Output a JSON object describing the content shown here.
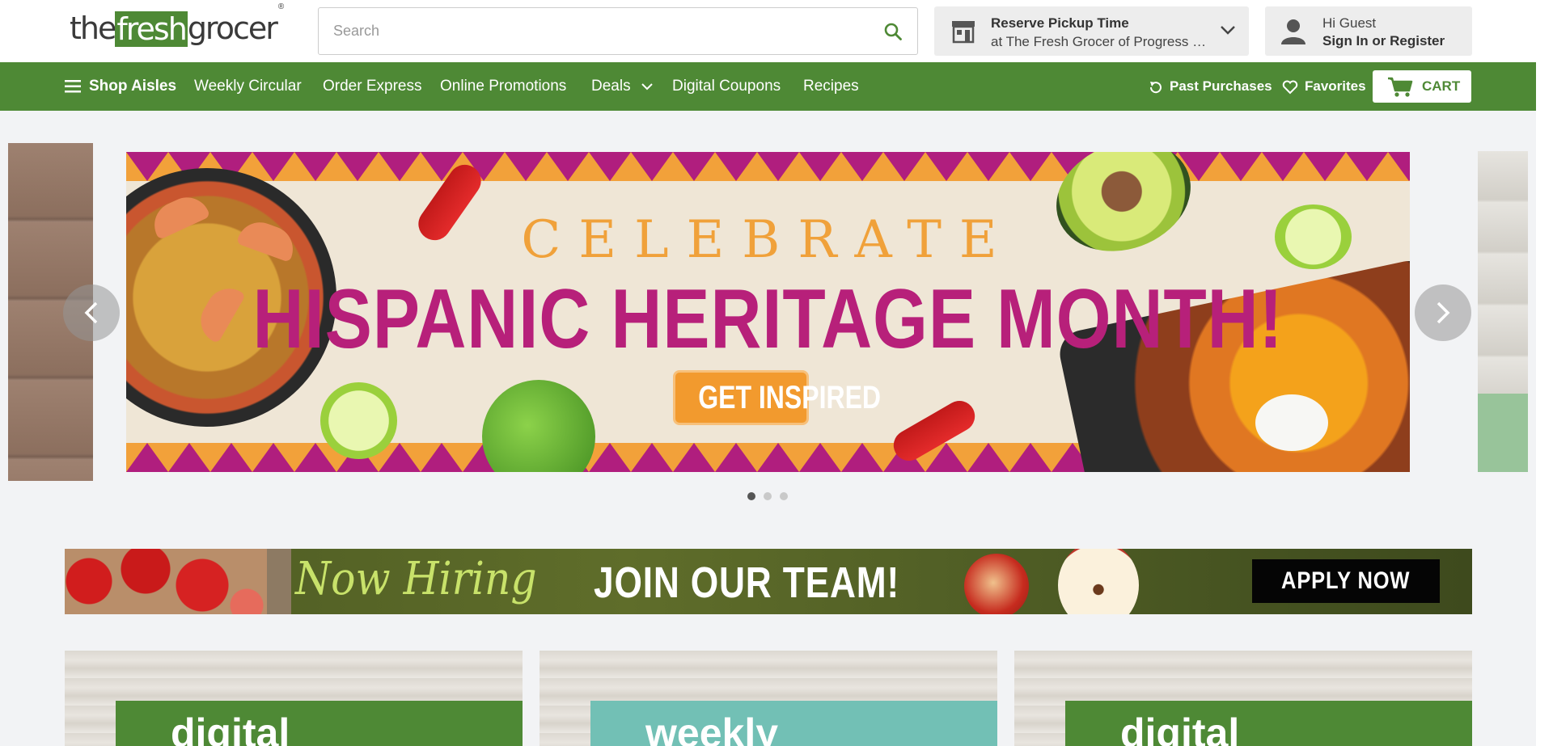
{
  "header": {
    "logo": {
      "the": "the",
      "fresh": "fresh",
      "grocer": "grocer",
      "mark": "®"
    },
    "search": {
      "placeholder": "Search",
      "icon": "search-icon"
    },
    "pickup": {
      "title": "Reserve Pickup Time",
      "store": "at The Fresh Grocer of Progress Plaza",
      "icon": "store-icon"
    },
    "account": {
      "greeting": "Hi Guest",
      "action": "Sign In or Register",
      "icon": "user-icon"
    }
  },
  "nav": {
    "shop_aisles": "Shop Aisles",
    "items": [
      "Weekly Circular",
      "Order Express",
      "Online Promotions",
      "Deals",
      "Digital Coupons",
      "Recipes"
    ],
    "past_purchases": "Past Purchases",
    "favorites": "Favorites",
    "cart": "CART"
  },
  "carousel": {
    "slide": {
      "celebrate": "CELEBRATE",
      "headline": "HISPANIC HERITAGE MONTH!",
      "cta": "GET INSPIRED"
    },
    "dots": 3,
    "active_dot": 0
  },
  "hiring": {
    "now_hiring": "Now Hiring",
    "join": "JOIN OUR TEAM!",
    "apply": "APPLY NOW"
  },
  "cards": [
    {
      "word": "digital"
    },
    {
      "word": "weekly"
    },
    {
      "word": "digital"
    }
  ],
  "colors": {
    "brand_green": "#4e8935",
    "headline_magenta": "#b7207a",
    "cta_orange": "#f29a2e",
    "teal": "#72c0b5"
  }
}
